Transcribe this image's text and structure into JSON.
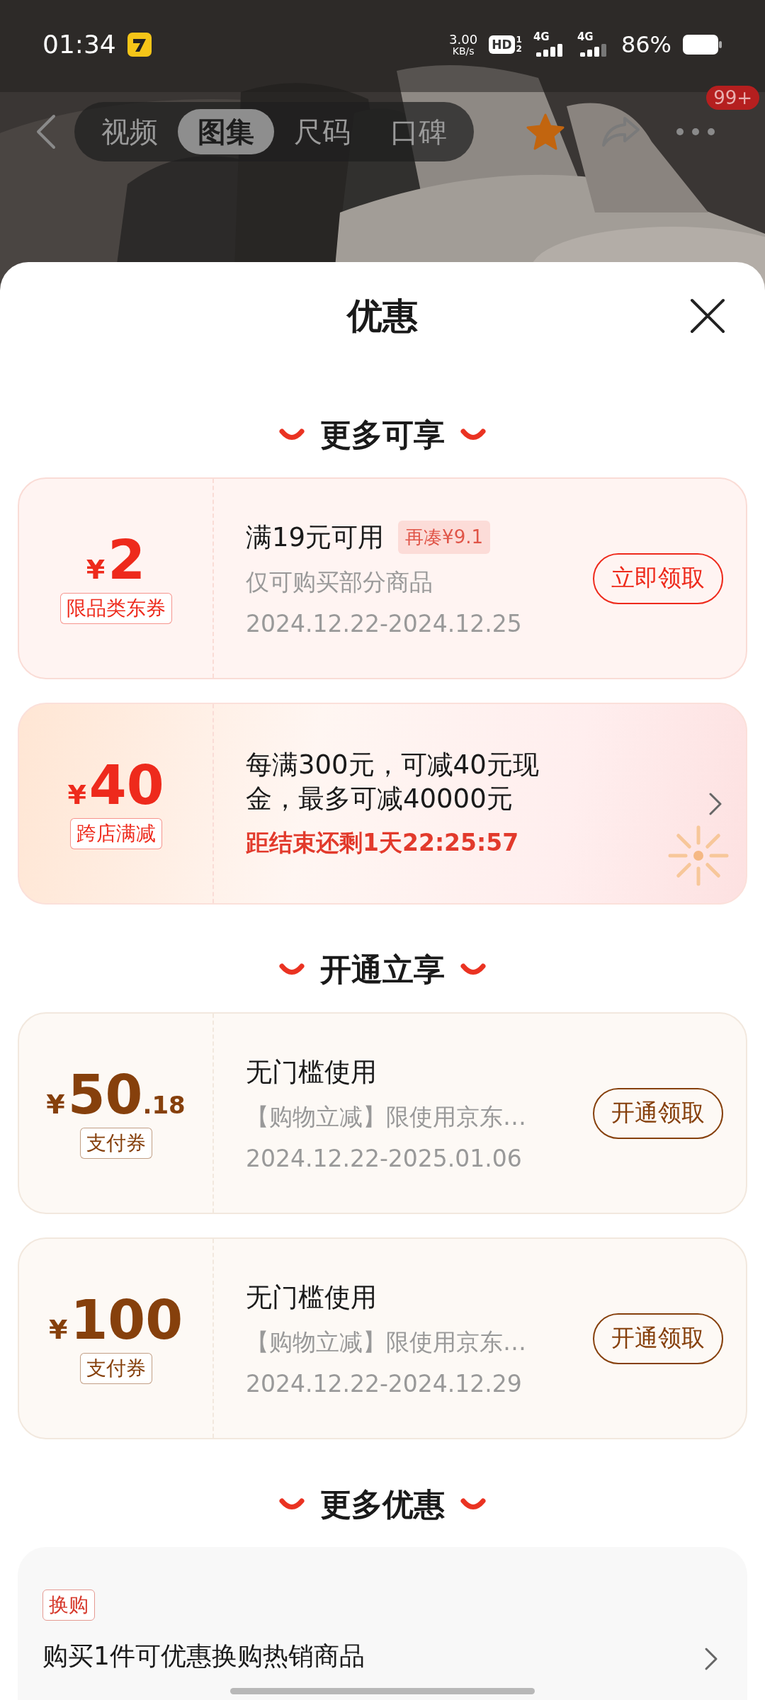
{
  "status_bar": {
    "time": "01:34",
    "net_speed": "3.00",
    "net_unit": "KB/s",
    "hd": "HD",
    "hd_slots": [
      "1",
      "2"
    ],
    "networks": [
      "4G",
      "4G"
    ],
    "battery": "86%"
  },
  "nav": {
    "tabs": [
      {
        "label": "视频",
        "selected": false
      },
      {
        "label": "图集",
        "selected": true
      },
      {
        "label": "尺码",
        "selected": false
      },
      {
        "label": "口碑",
        "selected": false
      }
    ],
    "favorite": true,
    "badge": "99+"
  },
  "sheet": {
    "title": "优惠",
    "sections": [
      {
        "title": "更多可享",
        "items": [
          {
            "kind": "claim",
            "color": "#ee2a1c",
            "currency": "¥",
            "amount": "2",
            "tag": "限品类东券",
            "title": "满19元可用",
            "hint": "再凑¥9.1",
            "desc": "仅可购买部分商品",
            "dates": "2024.12.22-2024.12.25",
            "button": "立即领取"
          },
          {
            "kind": "promo",
            "color": "#ee2a1c",
            "currency": "¥",
            "amount": "40",
            "tag": "跨店满减",
            "desc": "每满300元，可减40元现金，最多可减40000元",
            "countdown": "距结束还剩1天22:25:57"
          }
        ]
      },
      {
        "title": "开通立享",
        "items": [
          {
            "kind": "claim",
            "color": "#86400c",
            "currency": "¥",
            "amount": "50",
            "decimals": ".18",
            "tag": "支付券",
            "title": "无门槛使用",
            "desc": "【购物立减】限使用京东…",
            "dates": "2024.12.22-2025.01.06",
            "button": "开通领取"
          },
          {
            "kind": "claim",
            "color": "#86400c",
            "currency": "¥",
            "amount": "100",
            "tag": "支付券",
            "title": "无门槛使用",
            "desc": "【购物立减】限使用京东…",
            "dates": "2024.12.22-2024.12.29",
            "button": "开通领取"
          }
        ]
      },
      {
        "title": "更多优惠",
        "items": [
          {
            "kind": "offer",
            "tag": "换购",
            "text": "购买1件可优惠换购热销商品"
          }
        ]
      }
    ]
  }
}
